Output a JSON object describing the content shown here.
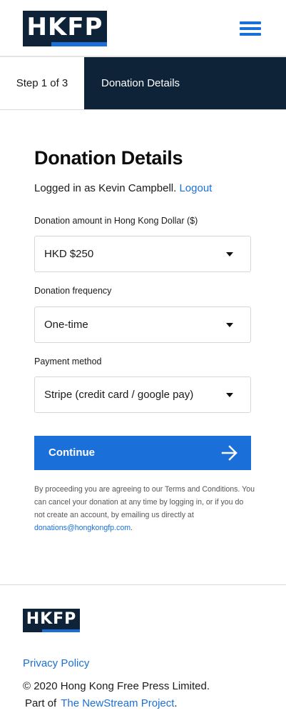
{
  "header": {
    "logo_text": "HKFP",
    "menu_icon": "hamburger-menu-icon"
  },
  "steps": {
    "count_label": "Step 1 of 3",
    "current_label": "Donation Details"
  },
  "form": {
    "title": "Donation Details",
    "logged_in_text": "Logged in as Kevin Campbell.",
    "logout_label": "Logout",
    "amount_label": "Donation amount in Hong Kong Dollar ($)",
    "amount_value": "HKD $250",
    "frequency_label": "Donation frequency",
    "frequency_value": "One-time",
    "payment_label": "Payment method",
    "payment_value": "Stripe (credit card / google pay)",
    "continue_label": "Continue",
    "continue_icon": "arrow-right-icon",
    "terms_text": "By proceeding you are agreeing to our Terms and Conditions. You can cancel your donation at any time by logging in, or if you do not create an account, by emailing us directly at",
    "terms_email": "donations@hongkongfp.com",
    "terms_end": "."
  },
  "footer": {
    "logo_text": "HKFP",
    "privacy_label": "Privacy Policy",
    "copyright": "© 2020 Hong Kong Free Press Limited.",
    "part_of_text": "Part of",
    "project_link": "The NewStream Project",
    "part_of_end": "."
  },
  "colors": {
    "navy": "#0e2238",
    "accent_blue": "#1a6fd8"
  }
}
